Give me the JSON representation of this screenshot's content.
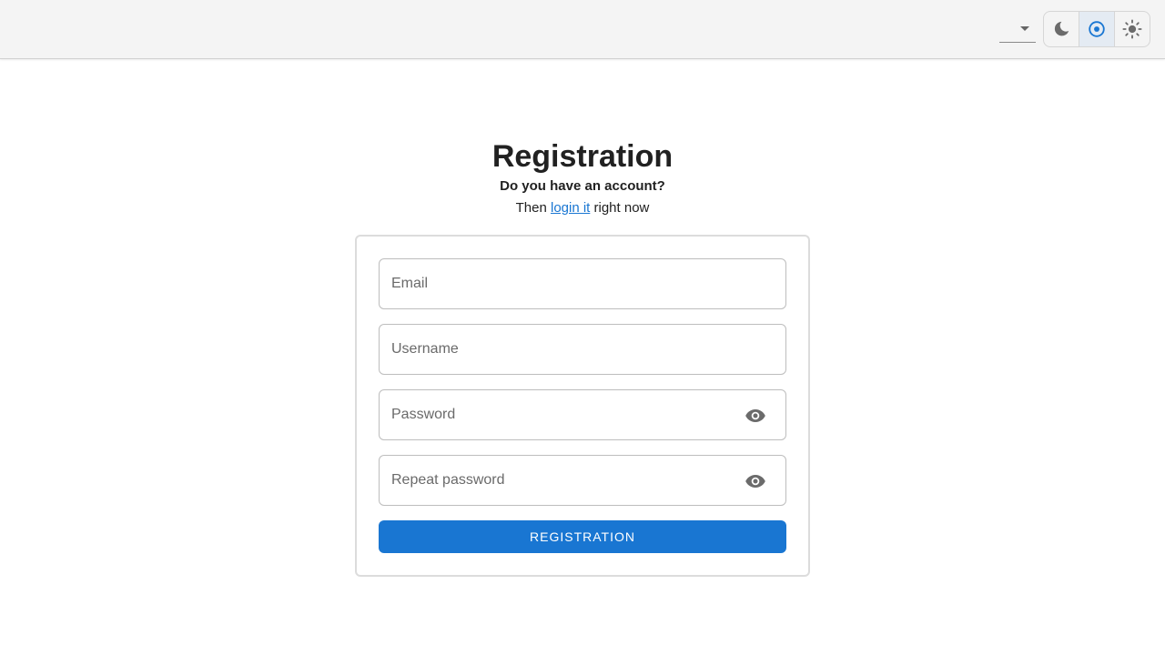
{
  "theme": {
    "accent": "#1976d2",
    "icons": [
      "moon-icon",
      "radio-target-icon",
      "sun-icon"
    ],
    "active": "system"
  },
  "header": {
    "title": "Registration",
    "subtitle": "Do you have an account?",
    "login_prefix": "Then",
    "login_link": "login it",
    "login_suffix": "right now"
  },
  "form": {
    "email_placeholder": "Email",
    "username_placeholder": "Username",
    "password_placeholder": "Password",
    "repeat_password_placeholder": "Repeat password",
    "submit_label": "REGISTRATION",
    "password_toggle_icon": "eye-icon",
    "repeat_password_toggle_icon": "eye-icon"
  }
}
